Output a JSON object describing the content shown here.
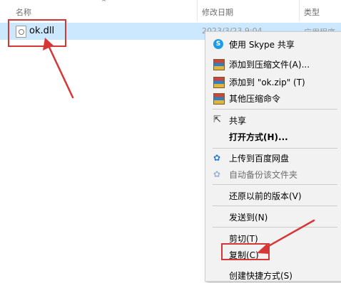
{
  "columns": {
    "name": "名称",
    "date": "修改日期",
    "type": "类型"
  },
  "file": {
    "name": "ok.dll",
    "date": "2023/3/23 9:04",
    "type": "应用程序扩"
  },
  "menu": {
    "skype": "使用 Skype 共享",
    "add_archive": "添加到压缩文件(A)...",
    "add_zip": "添加到 \"ok.zip\" (T)",
    "other_compress": "其他压缩命令",
    "share": "共享",
    "open_with": "打开方式(H)...",
    "upload_baidu": "上传到百度网盘",
    "auto_backup": "自动备份该文件夹",
    "restore": "还原以前的版本(V)",
    "send_to": "发送到(N)",
    "cut": "剪切(T)",
    "copy": "复制(C)",
    "create_shortcut": "创建快捷方式(S)"
  },
  "icons": {
    "skype": "S",
    "share": "⇱",
    "baidu": "✿",
    "sort": "⌃"
  },
  "colors": {
    "selection": "#cce8ff",
    "menu_bg": "#f2f2f2",
    "annotation": "#d73636"
  }
}
